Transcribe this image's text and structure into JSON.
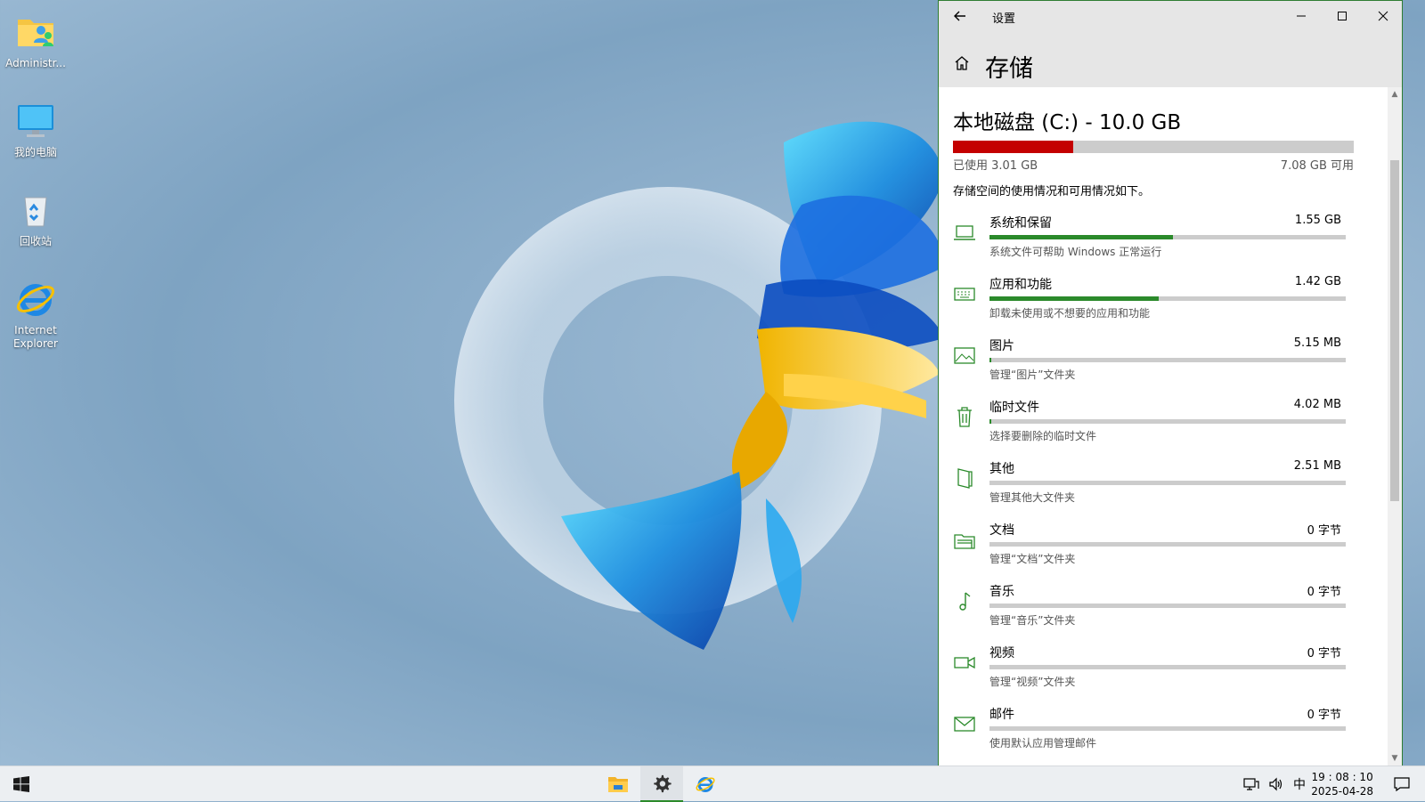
{
  "desktop": {
    "icons": [
      {
        "label": "Administr...",
        "icon": "user-folder-icon"
      },
      {
        "label": "我的电脑",
        "icon": "computer-icon"
      },
      {
        "label": "回收站",
        "icon": "recycle-bin-icon"
      },
      {
        "label": "Internet Explorer",
        "icon": "internet-explorer-icon"
      }
    ]
  },
  "settings": {
    "window_title": "设置",
    "page_title": "存储",
    "disk": {
      "title": "本地磁盘 (C:) - 10.0 GB",
      "used_fraction": 0.3,
      "used_label": "已使用 3.01 GB",
      "free_label": "7.08 GB 可用",
      "description": "存储空间的使用情况和可用情况如下。"
    },
    "categories": [
      {
        "name": "系统和保留",
        "size": "1.55 GB",
        "fraction": 0.515,
        "desc": "系统文件可帮助 Windows 正常运行",
        "icon": "laptop-icon"
      },
      {
        "name": "应用和功能",
        "size": "1.42 GB",
        "fraction": 0.474,
        "desc": "卸载未使用或不想要的应用和功能",
        "icon": "keyboard-icon"
      },
      {
        "name": "图片",
        "size": "5.15 MB",
        "fraction": 0.003,
        "desc": "管理“图片”文件夹",
        "icon": "picture-icon"
      },
      {
        "name": "临时文件",
        "size": "4.02 MB",
        "fraction": 0.003,
        "desc": "选择要删除的临时文件",
        "icon": "trash-icon"
      },
      {
        "name": "其他",
        "size": "2.51 MB",
        "fraction": 0.0,
        "desc": "管理其他大文件夹",
        "icon": "other-files-icon"
      },
      {
        "name": "文档",
        "size": "0 字节",
        "fraction": 0.0,
        "desc": "管理“文档”文件夹",
        "icon": "documents-icon"
      },
      {
        "name": "音乐",
        "size": "0 字节",
        "fraction": 0.0,
        "desc": "管理“音乐”文件夹",
        "icon": "music-icon"
      },
      {
        "name": "视频",
        "size": "0 字节",
        "fraction": 0.0,
        "desc": "管理“视频”文件夹",
        "icon": "video-icon"
      },
      {
        "name": "邮件",
        "size": "0 字节",
        "fraction": 0.0,
        "desc": "使用默认应用管理邮件",
        "icon": "mail-icon"
      }
    ]
  },
  "taskbar": {
    "ime": "中",
    "time": "19 : 08 : 10",
    "date": "2025-04-28",
    "apps": [
      "file-explorer-icon",
      "settings-gear-icon",
      "internet-explorer-icon"
    ]
  },
  "colors": {
    "accent": "#2b8a2b",
    "disk_used": "#c40000",
    "bar_track": "#cccccc"
  }
}
